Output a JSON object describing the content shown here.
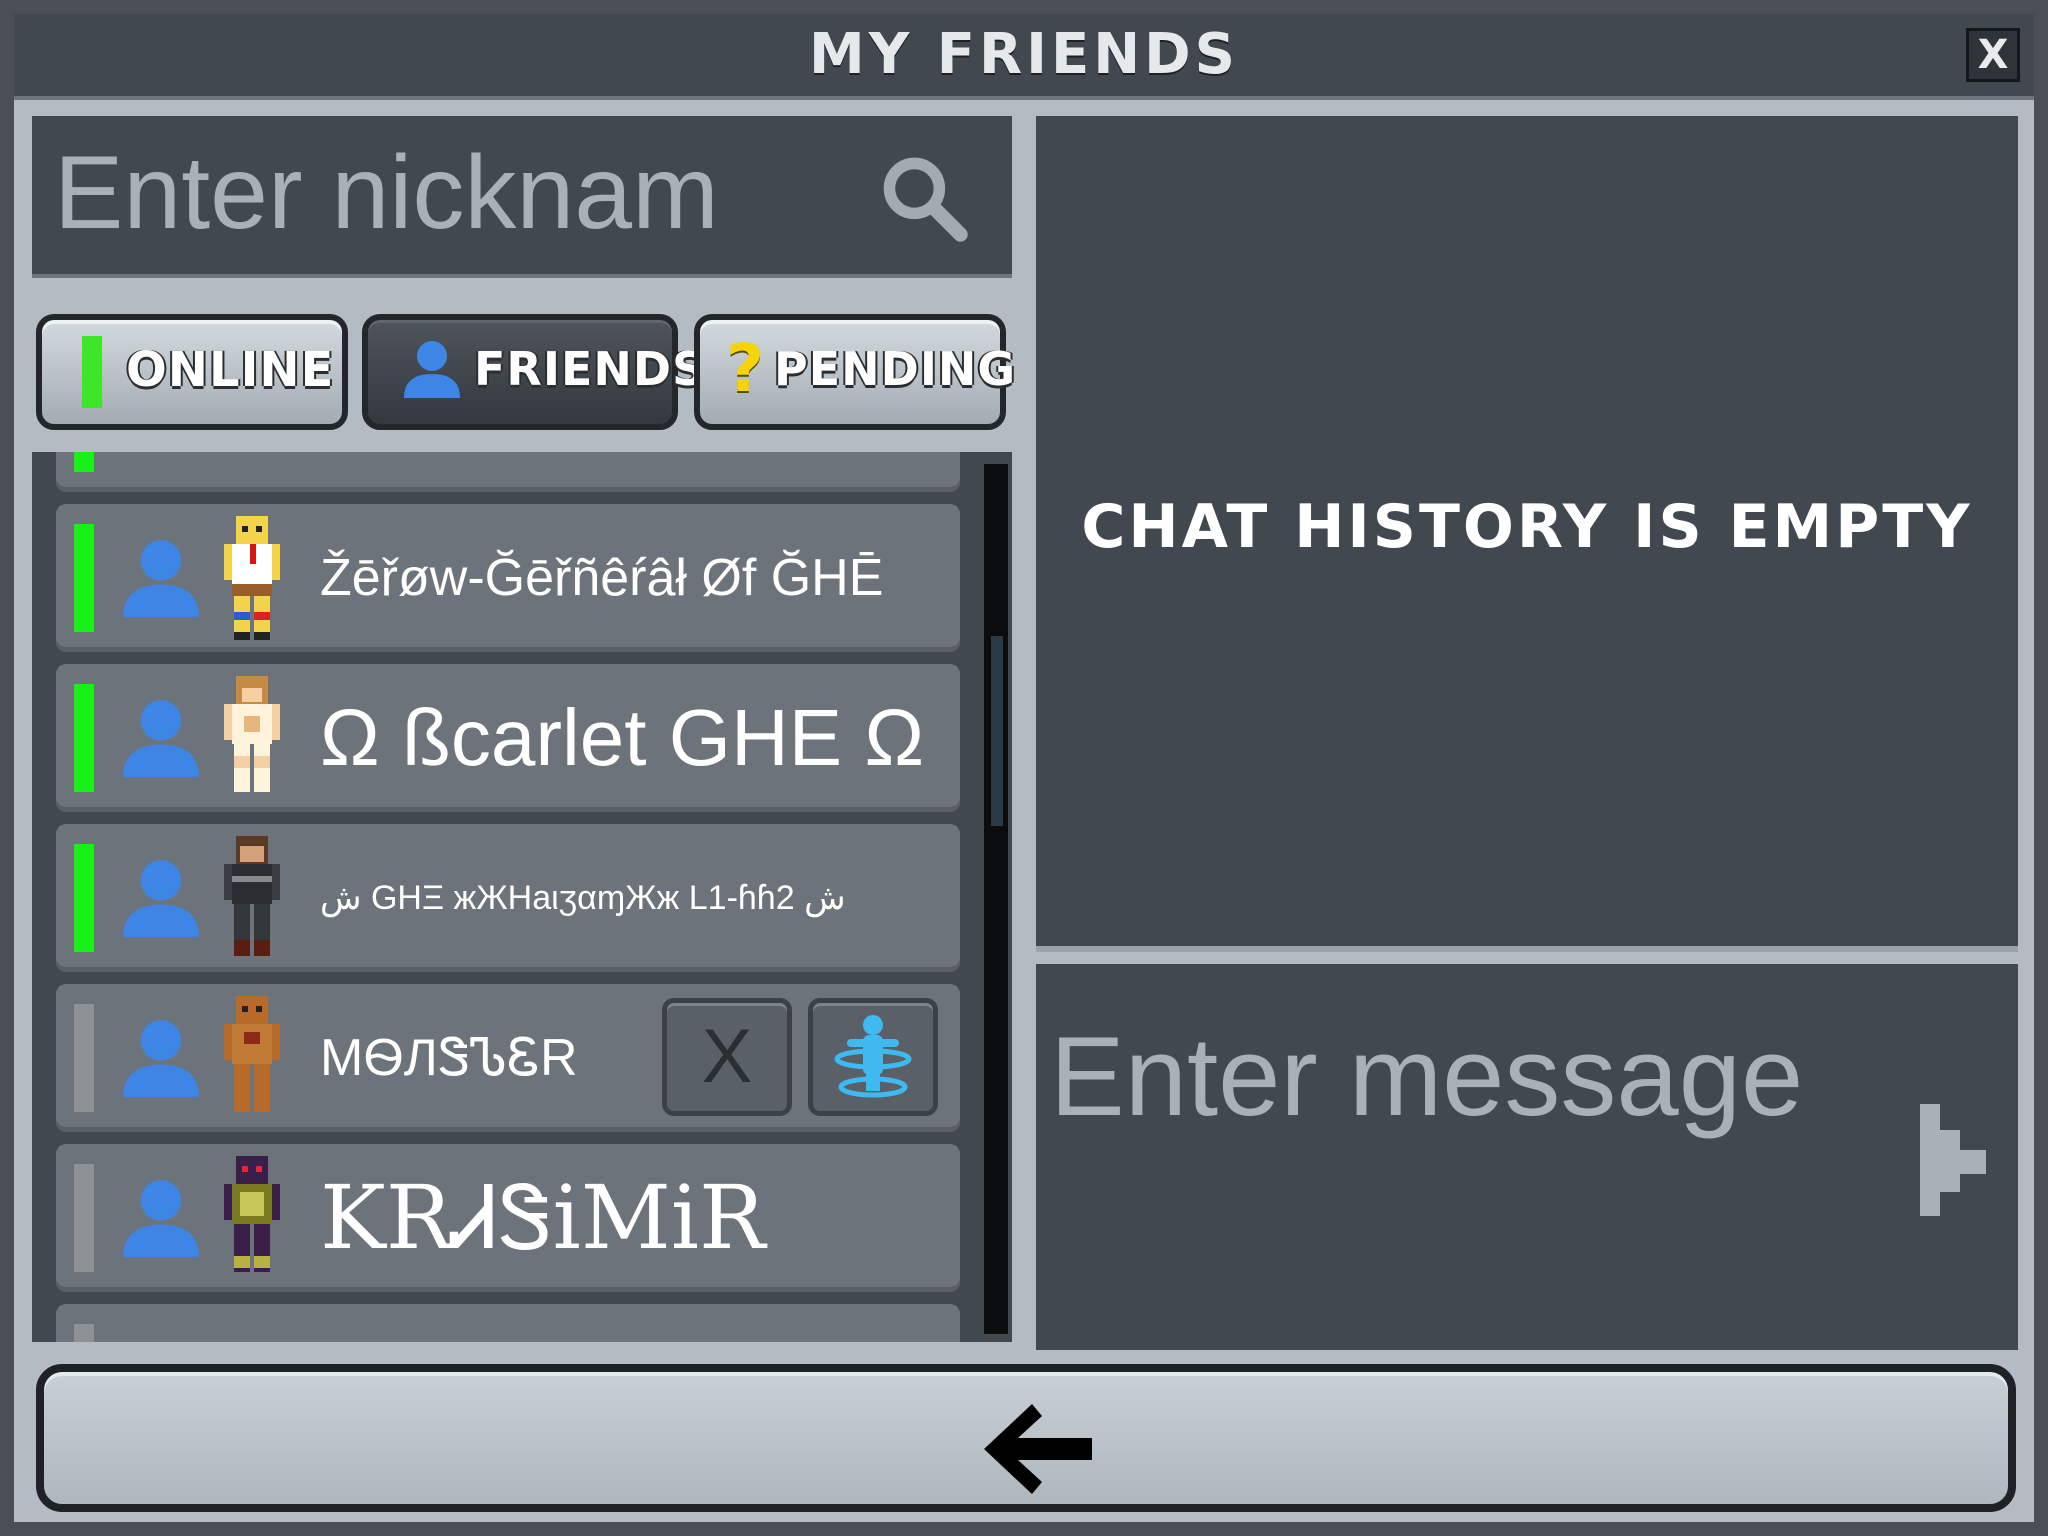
{
  "window": {
    "title": "MY FRIENDS",
    "close_label": "X"
  },
  "search": {
    "placeholder": "Enter nicknam",
    "icon": "search-icon"
  },
  "tabs": [
    {
      "label": "ONLINE",
      "icon": "online-status-icon",
      "active": false
    },
    {
      "label": "FRIENDS",
      "icon": "person-icon",
      "active": true
    },
    {
      "label": "PENDING",
      "icon": "question-icon",
      "active": false
    }
  ],
  "friends": [
    {
      "name": "Žēřøw-Ğēřñêŕâł Øf ĞHĒ",
      "online": true
    },
    {
      "name": "Ω ßcarlet GHE Ω",
      "online": true
    },
    {
      "name": "ش GHΞ жЖНаιʒαɱЖж L1-ɦɦ2 ش",
      "online": true
    },
    {
      "name": "MѲЛᏕᏖᏋR",
      "online": false,
      "remove_label": "X"
    },
    {
      "name": "KRᏗᏕiMiR",
      "online": false
    }
  ],
  "chat": {
    "empty_text": "CHAT HISTORY IS EMPTY",
    "input_placeholder": "Enter message"
  },
  "colors": {
    "online": "#19f019",
    "offline": "#8d9195",
    "panel": "#424850",
    "frame": "#b3bcc3"
  }
}
